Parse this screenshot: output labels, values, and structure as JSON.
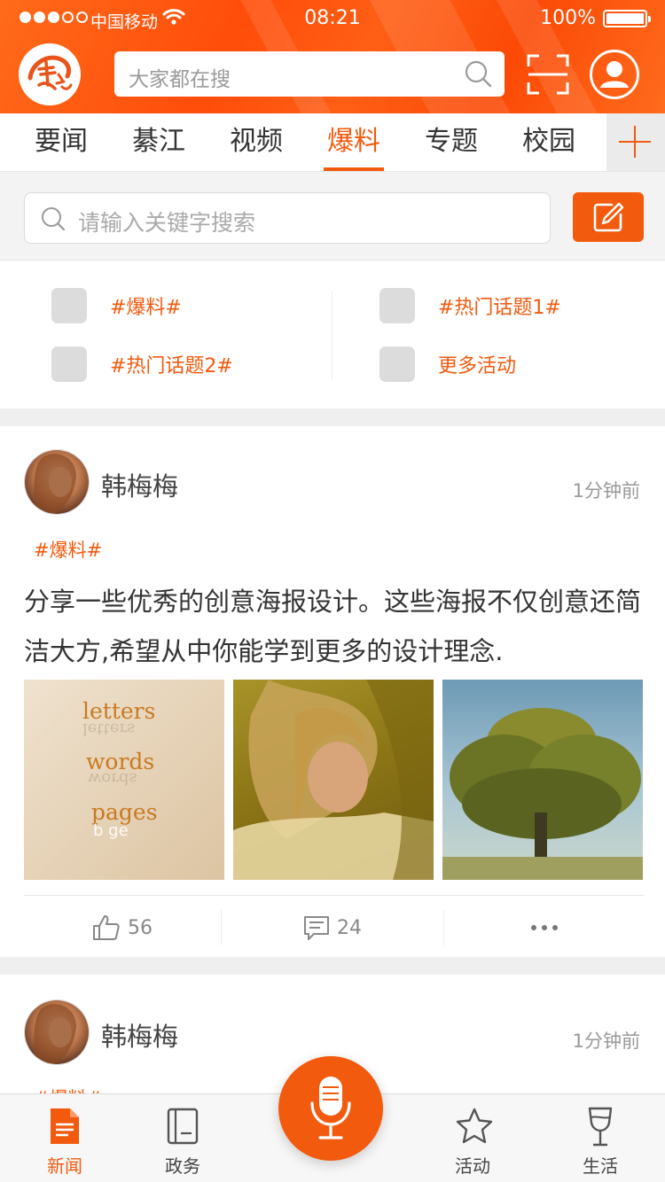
{
  "status": {
    "carrier": "中国移动",
    "time": "08:21",
    "battery": "100%"
  },
  "header": {
    "search_placeholder": "大家都在搜"
  },
  "tabs": [
    {
      "label": "要闻"
    },
    {
      "label": "綦江"
    },
    {
      "label": "视频"
    },
    {
      "label": "爆料",
      "active": true
    },
    {
      "label": "专题"
    },
    {
      "label": "校园"
    }
  ],
  "search": {
    "placeholder": "请输入关键字搜索"
  },
  "topics": [
    {
      "label": "#爆料#"
    },
    {
      "label": "#热门话题1#"
    },
    {
      "label": "#热门话题2#"
    },
    {
      "label": "更多活动"
    }
  ],
  "posts": [
    {
      "author": "韩梅梅",
      "time": "1分钟前",
      "tag": "#爆料#",
      "text": "分享一些优秀的创意海报设计。这些海报不仅创意还简洁大方,希望从中你能学到更多的设计理念.",
      "images": [
        {
          "kind": "letters-poster",
          "words": [
            "letters",
            "words",
            "pages"
          ]
        },
        {
          "kind": "portrait-photo"
        },
        {
          "kind": "tree-photo"
        }
      ],
      "likes": "56",
      "comments": "24"
    },
    {
      "author": "韩梅梅",
      "time": "1分钟前",
      "tag": "#爆料#"
    }
  ],
  "tabbar": [
    {
      "label": "新闻",
      "icon": "news-icon",
      "active": true
    },
    {
      "label": "政务",
      "icon": "book-icon"
    },
    {
      "label": "活动",
      "icon": "star-icon"
    },
    {
      "label": "生活",
      "icon": "wine-glass-icon"
    }
  ],
  "colors": {
    "accent": "#f25a0e",
    "header": "#ff5a12"
  }
}
